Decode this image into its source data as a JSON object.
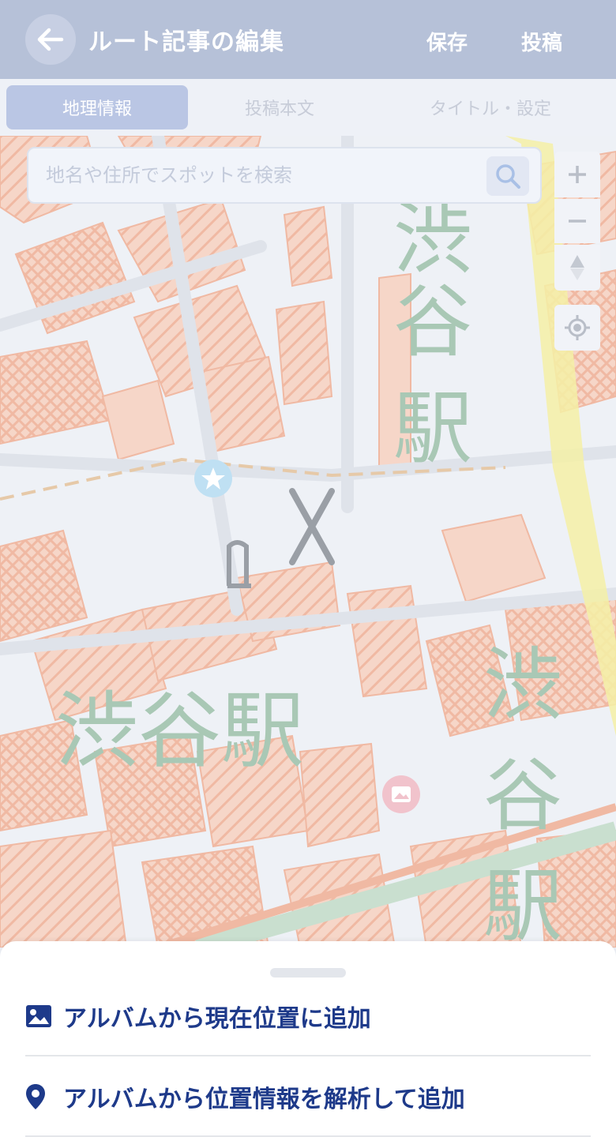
{
  "header": {
    "title": "ルート記事の編集",
    "save_label": "保存",
    "post_label": "投稿"
  },
  "tabs": [
    {
      "label": "地理情報",
      "active": true
    },
    {
      "label": "投稿本文",
      "active": false
    },
    {
      "label": "タイトル・設定",
      "active": false
    }
  ],
  "search": {
    "placeholder": "地名や住所でスポットを検索"
  },
  "map": {
    "labels": [
      "渋谷駅",
      "渋谷駅",
      "渋",
      "谷",
      "駅"
    ],
    "station_label_top": [
      "渋",
      "谷",
      "駅"
    ],
    "station_label_bottom": "渋谷駅",
    "station_label_right": [
      "渋",
      "谷",
      "駅"
    ]
  },
  "bottom_sheet": {
    "items": [
      {
        "label": "アルバムから現在位置に追加",
        "icon": "image-icon"
      },
      {
        "label": "アルバムから位置情報を解析して追加",
        "icon": "map-pin-icon"
      }
    ]
  },
  "colors": {
    "header_bg": "#b6c1d8",
    "accent": "#1e3a8a",
    "map_building": "#f3c8b6",
    "map_label": "#9bbcaa"
  }
}
